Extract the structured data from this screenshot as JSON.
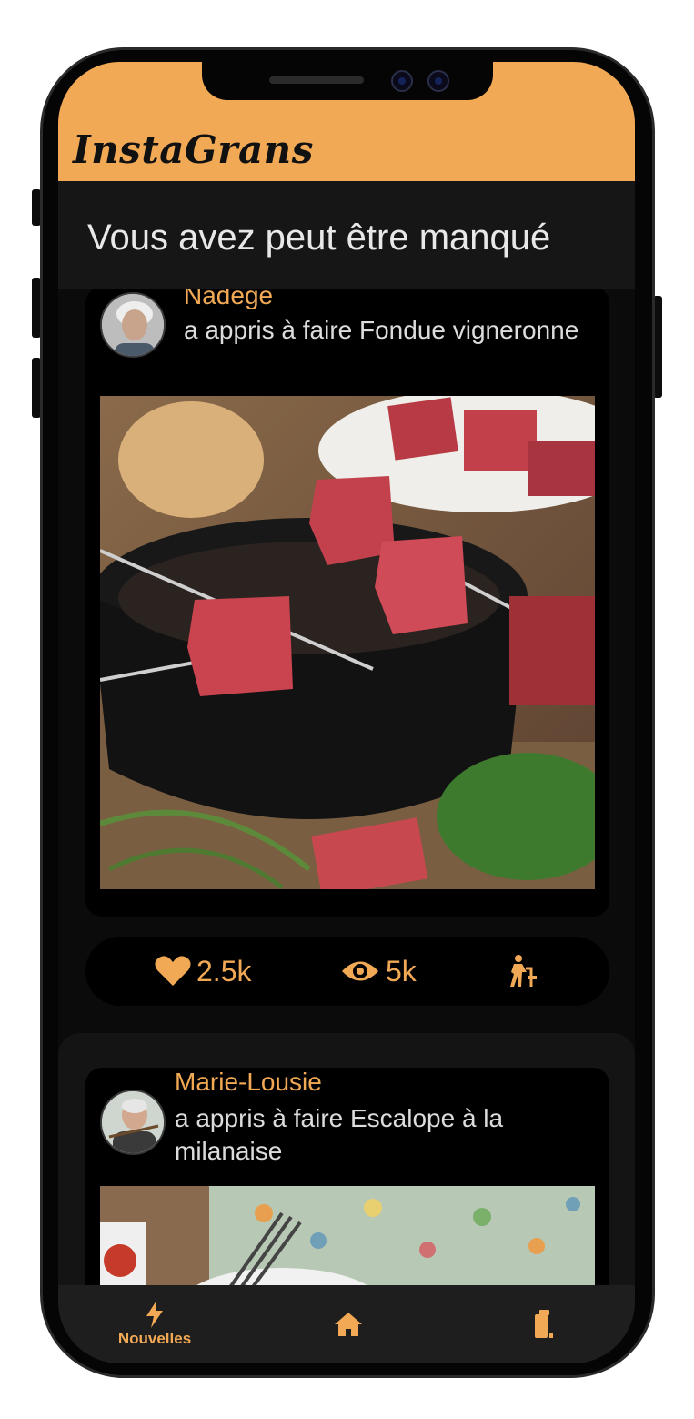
{
  "app": {
    "name": "InstaGrans",
    "accent": "#f2a955"
  },
  "section": {
    "title": "Vous avez peut être manqué"
  },
  "posts": [
    {
      "author": "Nadege",
      "action": "a appris à faire Fondue vigneronne",
      "image": "fondue-meat-photo",
      "stats": {
        "likes": "2.5k",
        "views": "5k"
      }
    },
    {
      "author": "Marie-Lousie",
      "action": "a appris à faire Escalope à la milanaise",
      "image": "escalope-photo"
    }
  ],
  "nav": {
    "items": [
      {
        "label": "Nouvelles",
        "icon": "bolt-icon",
        "active": true
      },
      {
        "label": "",
        "icon": "home-icon"
      },
      {
        "label": "",
        "icon": "device-icon"
      }
    ]
  }
}
